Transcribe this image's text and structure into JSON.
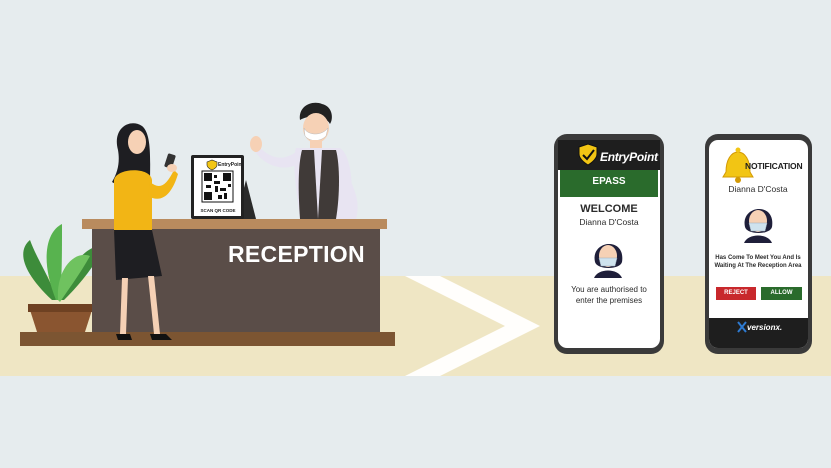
{
  "colors": {
    "background": "#e6ecee",
    "floor": "#efe6c4",
    "desk": "#5a4d48",
    "desk_top": "#b98b5e",
    "epass_green": "#2a6b2c",
    "reject_red": "#c8282c",
    "phone_body": "#3a3a3a"
  },
  "reception": {
    "sign": "RECEPTION"
  },
  "kiosk": {
    "brand": "EntryPoint",
    "scan_label": "SCAN QR CODE"
  },
  "epass_phone": {
    "brand": "EntryPoint",
    "header": "EPASS",
    "welcome": "WELCOME",
    "name": "Dianna D'Costa",
    "message": "You are authorised to enter the premises",
    "icons": [
      "shield-logo-icon",
      "visitor-avatar-icon"
    ]
  },
  "notification_phone": {
    "title": "NOTIFICATION",
    "name": "Dianna D'Costa",
    "message": "Has Come To Meet You And Is Waiting At The Reception Area",
    "reject_label": "REJECT",
    "allow_label": "ALLOW",
    "footer": "versionx.",
    "icons": [
      "bell-icon",
      "visitor-avatar-icon",
      "versionx-logo-icon"
    ]
  }
}
